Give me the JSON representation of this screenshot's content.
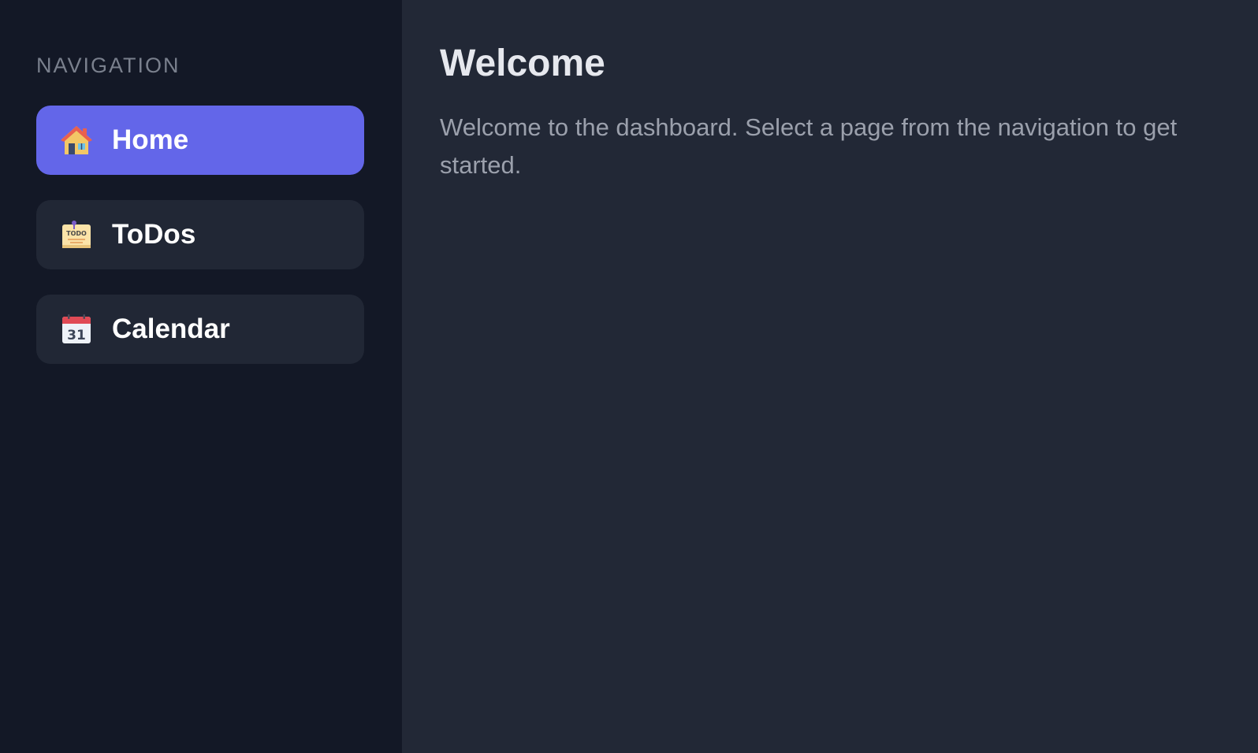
{
  "sidebar": {
    "heading": "NAVIGATION",
    "items": [
      {
        "label": "Home",
        "icon": "house-icon",
        "active": true
      },
      {
        "label": "ToDos",
        "icon": "todo-note-icon",
        "active": false
      },
      {
        "label": "Calendar",
        "icon": "calendar-icon",
        "active": false
      }
    ],
    "calendar_icon_text": "31",
    "todo_icon_text": "TODO"
  },
  "main": {
    "title": "Welcome",
    "text": "Welcome to the dashboard. Select a page from the navigation to get started."
  },
  "colors": {
    "sidebar_bg": "#131826",
    "main_bg": "#222836",
    "accent": "#6366e9",
    "item_bg": "#212735"
  }
}
